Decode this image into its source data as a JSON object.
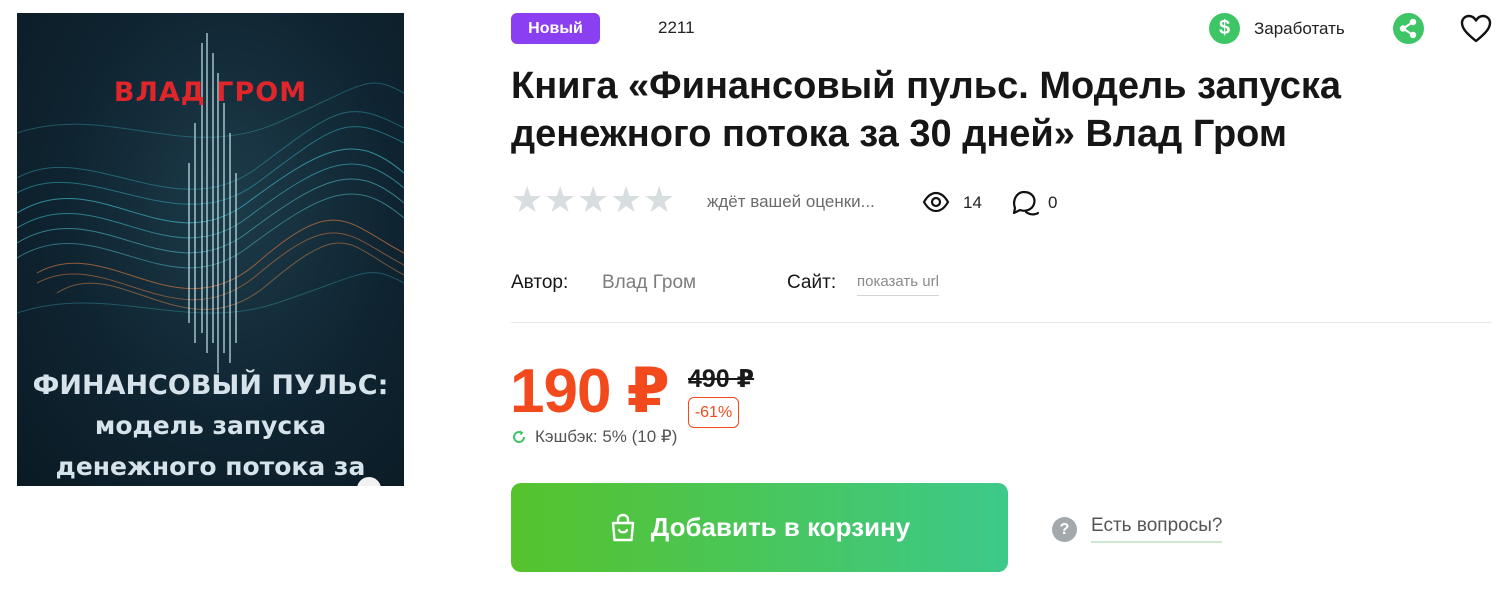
{
  "cover": {
    "author": "ВЛАД ГРОМ",
    "title_line1": "ФИНАНСОВЫЙ ПУЛЬС:",
    "title_line2": "модель запуска",
    "title_line3": "денежного потока за"
  },
  "header": {
    "badge": "Новый",
    "item_id": "2211",
    "earn_label": "Заработать",
    "earn_icon": "dollar-icon",
    "share_icon": "share-icon",
    "favorite_icon": "heart-icon"
  },
  "product": {
    "title": "Книга «Финансовый пульс. Модель запуска денежного потока за 30 дней» Влад Гром",
    "rating_stars": 0,
    "rating_max": 5,
    "rating_text": "ждёт вашей оценки...",
    "views": "14",
    "comments": "0",
    "author_label": "Автор:",
    "author_value": "Влад Гром",
    "site_label": "Сайт:",
    "site_link": "показать url"
  },
  "pricing": {
    "price": "190 ₽",
    "old_price": "490 ₽",
    "discount": "-61%",
    "cashback": "Кэшбэк: 5% (10 ₽)"
  },
  "actions": {
    "cart_label": "Добавить в корзину",
    "questions_label": "Есть вопросы?"
  },
  "colors": {
    "accent_purple": "#8a3ff0",
    "price_red": "#f24a1c",
    "green": "#3ec566"
  }
}
